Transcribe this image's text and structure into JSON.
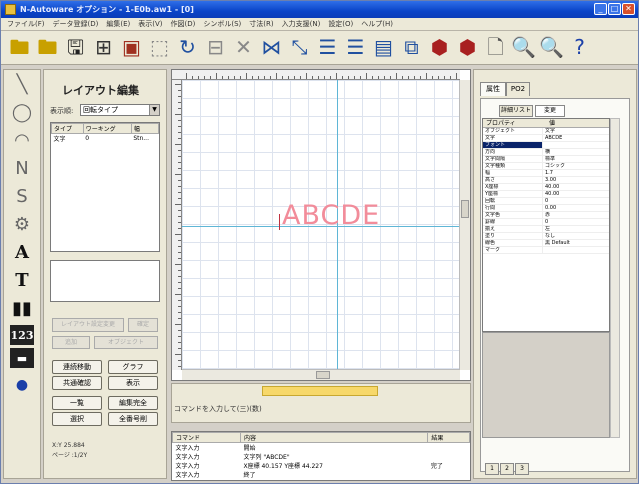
{
  "window": {
    "title": "N-Autoware オプション - 1-E0b.aw1 - [0]"
  },
  "menu": {
    "items": [
      "ファイル(F)",
      "データ登録(D)",
      "編集(E)",
      "表示(V)",
      "作図(D)",
      "シンボル(S)",
      "寸法(R)",
      "入力支援(N)",
      "設定(O)",
      "ヘルプ(H)"
    ]
  },
  "toolbar": {
    "buttons": [
      {
        "name": "open-folder-icon",
        "glyph": "🖿",
        "color": "#c8a000"
      },
      {
        "name": "open-folder2-icon",
        "glyph": "🖿",
        "color": "#c8a000"
      },
      {
        "name": "save-icon",
        "glyph": "🖫",
        "color": "#222"
      },
      {
        "name": "frame-icon",
        "glyph": "⊞",
        "color": "#333"
      },
      {
        "name": "print-icon",
        "glyph": "▣",
        "color": "#a03020"
      },
      {
        "name": "select-icon",
        "glyph": "⬚",
        "color": "#888"
      },
      {
        "name": "rotate-icon",
        "glyph": "↻",
        "color": "#2050a0"
      },
      {
        "name": "grid-icon",
        "glyph": "⊟",
        "color": "#888"
      },
      {
        "name": "delete-icon",
        "glyph": "✕",
        "color": "#888"
      },
      {
        "name": "mirror-icon",
        "glyph": "⋈",
        "color": "#2050a0"
      },
      {
        "name": "scale-icon",
        "glyph": "⤡",
        "color": "#2050a0"
      },
      {
        "name": "align-left-icon",
        "glyph": "☰",
        "color": "#2050a0"
      },
      {
        "name": "align-center-icon",
        "glyph": "☰",
        "color": "#2050a0"
      },
      {
        "name": "list-icon",
        "glyph": "▤",
        "color": "#2050a0"
      },
      {
        "name": "text-icon",
        "glyph": "⧉",
        "color": "#2050a0"
      },
      {
        "name": "record-red-icon",
        "glyph": "⬢",
        "color": "#a82020"
      },
      {
        "name": "record-red2-icon",
        "glyph": "⬢",
        "color": "#a82020"
      },
      {
        "name": "page-icon",
        "glyph": "🗋",
        "color": "#555"
      },
      {
        "name": "zoom-in-icon",
        "glyph": "🔍",
        "color": "#208040"
      },
      {
        "name": "zoom-out-icon",
        "glyph": "🔍",
        "color": "#208040"
      },
      {
        "name": "help-icon",
        "glyph": "?",
        "color": "#1a3fa8"
      }
    ]
  },
  "toolbox": {
    "tools": [
      {
        "name": "line-tool-icon",
        "glyph": "╲",
        "dark": false
      },
      {
        "name": "circle-tool-icon",
        "glyph": "◯",
        "dark": false
      },
      {
        "name": "arc-tool-icon",
        "glyph": "◠",
        "dark": false
      },
      {
        "name": "polyline-tool-icon",
        "glyph": "Ν",
        "dark": false
      },
      {
        "name": "spline-tool-icon",
        "glyph": "S",
        "dark": false
      },
      {
        "name": "symbol-tool-icon",
        "glyph": "⚙",
        "dark": false
      },
      {
        "name": "text-a-tool-icon",
        "glyph": "A",
        "dark": true
      },
      {
        "name": "text-t-tool-icon",
        "glyph": "T",
        "dark": true
      },
      {
        "name": "barcode-tool-icon",
        "glyph": "▮▮",
        "dark": true
      },
      {
        "name": "number-tool-icon",
        "glyph": "123",
        "dark": true
      },
      {
        "name": "counter-tool-icon",
        "glyph": "▬",
        "dark": true
      },
      {
        "name": "dot-tool-icon",
        "glyph": "●",
        "dark": true
      }
    ]
  },
  "layout_panel": {
    "title": "レイアウト編集",
    "select_label": "表示順:",
    "select_value": "回転タイプ",
    "list_headers": [
      "タイプ",
      "ワーキング",
      "幅"
    ],
    "list_rows": [
      [
        "文字",
        "0",
        "Stn..."
      ]
    ],
    "disabled_buttons": [
      "レイアウト設定変更",
      "確定",
      "追加",
      "オブジェクト"
    ],
    "buttons": [
      "連続移動",
      "グラフ",
      "共通確認",
      "表示",
      "一覧",
      "編集完全",
      "選択",
      "全番号削"
    ],
    "status_line1": "X:Y 25.884",
    "status_line2": "ページ :1/2Y"
  },
  "canvas": {
    "sample_text": "ABCDE",
    "text_color": "#f28c9a",
    "axis_color": "#5fb6d6"
  },
  "command": {
    "prompt": "コマンドを入力して(三)(数)"
  },
  "history": {
    "headers": [
      "コマンド",
      "内容",
      "結果"
    ],
    "rows": [
      [
        "文字入力",
        "開始",
        ""
      ],
      [
        "文字入力",
        "文字列 \"ABCDE\"",
        ""
      ],
      [
        "文字入力",
        "X座標 40.157  Y座標 44.227",
        "完了"
      ],
      [
        "文字入力",
        "終了",
        ""
      ]
    ]
  },
  "property_panel": {
    "tabs": [
      "属性",
      "PO2"
    ],
    "inner_tabs": [
      "詳細リスト",
      "変更"
    ],
    "table_headers": [
      "プロパティ",
      "値"
    ],
    "rows": [
      {
        "key": "オブジェクト",
        "value": "文字"
      },
      {
        "key": "文字",
        "value": "ABCDE"
      },
      {
        "key": "フォント",
        "value": ""
      },
      {
        "key": "方向",
        "value": "横"
      },
      {
        "key": "文字間隔",
        "value": "標準"
      },
      {
        "key": "文字種類",
        "value": "ゴシック"
      },
      {
        "key": "幅",
        "value": "1.7"
      },
      {
        "key": "高さ",
        "value": "3.00"
      },
      {
        "key": "X座標",
        "value": "40.00"
      },
      {
        "key": "Y座標",
        "value": "40.00"
      },
      {
        "key": "回転",
        "value": "0"
      },
      {
        "key": "行間",
        "value": "0.00"
      },
      {
        "key": "文字色",
        "value": "赤"
      },
      {
        "key": "罫線",
        "value": "0"
      },
      {
        "key": "揃え",
        "value": "左"
      },
      {
        "key": "塗り",
        "value": "なし"
      },
      {
        "key": "線色",
        "value": "黒 Default"
      },
      {
        "key": "マーク",
        "value": ""
      }
    ],
    "selected_row": 2
  },
  "bottom_tabs": [
    "1",
    "2",
    "3"
  ]
}
